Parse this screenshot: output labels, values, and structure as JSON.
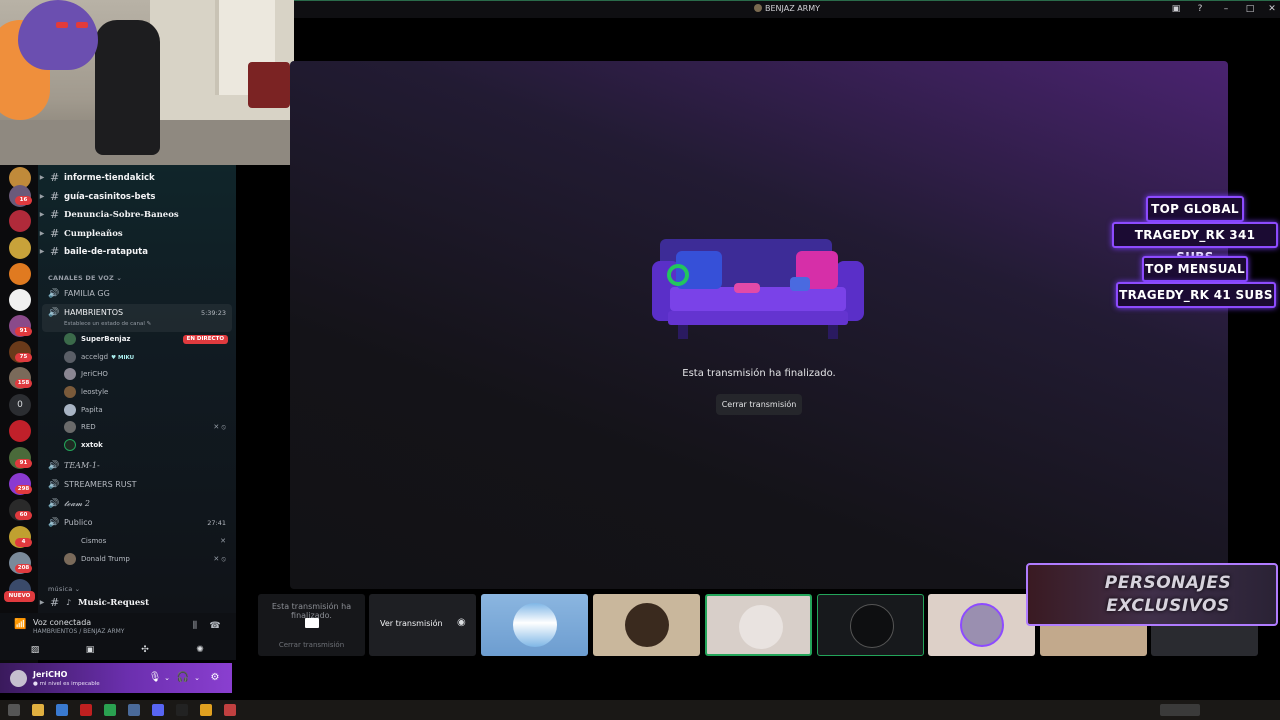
{
  "window": {
    "title": "BENJAZ ARMY"
  },
  "servers": {
    "badges": [
      "16",
      "91",
      "75",
      "158",
      "91",
      "298",
      "60",
      "4",
      "208"
    ],
    "zero_label": "0",
    "nuevo_label": "NUEVO"
  },
  "channels": {
    "text": [
      {
        "name": "informe-tiendakick"
      },
      {
        "name": "guía-casinitos-bets"
      },
      {
        "name": "Denuncia-Sobre-Baneos"
      },
      {
        "name": "Cumpleaños"
      },
      {
        "name": "baile-de-rataputa"
      }
    ],
    "voice_category": "CANALES DE VOZ",
    "voice": {
      "familia": "FAMILIA GG",
      "hambrientos": "HAMBRIENTOS",
      "hambrientos_time": "5:39:23",
      "hambrientos_status": "Establece un estado de canal",
      "members": [
        {
          "name": "SuperBenjaz",
          "live": "EN DIRECTO"
        },
        {
          "name": "accelgd",
          "tag": "MIKU"
        },
        {
          "name": "JeriCHO"
        },
        {
          "name": "leostyle"
        },
        {
          "name": "Papita"
        },
        {
          "name": "RED"
        },
        {
          "name": "xxtok"
        }
      ],
      "team1": "𝑇𝐸𝐴𝑀-1-",
      "streamers_rust": "STREAMERS RUST",
      "team2": "𝓽𝓮𝓪𝓶 2",
      "publico": "Publico",
      "publico_time": "27:41",
      "publico_members": [
        {
          "name": "Cismos"
        },
        {
          "name": "Donald Trump"
        }
      ]
    },
    "music_category": "música",
    "music_channel": "Music-Request"
  },
  "voice_panel": {
    "title": "Voz conectada",
    "subtitle": "HAMBRIENTOS / BENJAZ ARMY"
  },
  "user_panel": {
    "name": "JeriCHO",
    "status": "mi nivel es impecable"
  },
  "stream": {
    "ended_text": "Esta transmisión ha finalizado.",
    "close_button": "Cerrar transmisión"
  },
  "tiles": {
    "ended_tile_text": "Esta transmisión ha finalizado.",
    "ended_tile_close": "Cerrar transmisión",
    "watch_label": "Ver transmisión"
  },
  "overlay": {
    "top_global_label": "TOP GLOBAL",
    "top_global_value": "TRAGEDY_RK 341 SUBS",
    "top_mensual_label": "TOP MENSUAL",
    "top_mensual_value": "TRAGEDY_RK 41 SUBS",
    "promo_line1": "PERSONAJES",
    "promo_line2": "EXCLUSIVOS"
  },
  "colors": {
    "accent_green": "#23a55a",
    "live_red": "#e03a3e",
    "overlay_purple": "#8d4bff"
  }
}
